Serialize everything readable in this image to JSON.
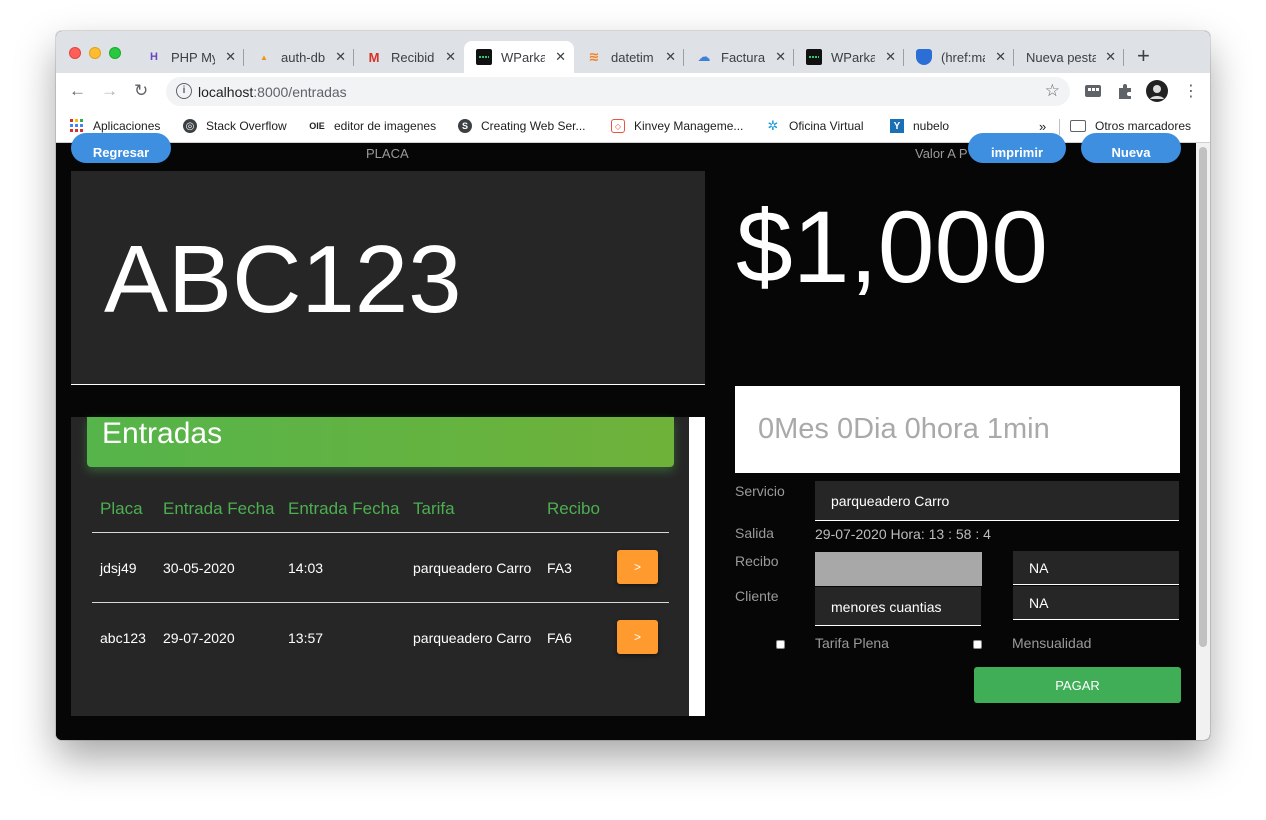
{
  "browser": {
    "tabs": [
      {
        "title": "PHP My",
        "icon": "phpmyadmin-icon",
        "color": "#6c45c4"
      },
      {
        "title": "auth-db",
        "icon": "pma-icon",
        "color": "#f29111"
      },
      {
        "title": "Recibid",
        "icon": "gmail-icon",
        "color": "#d93025"
      },
      {
        "title": "WParka",
        "icon": "wparking-icon",
        "color": "#111111"
      },
      {
        "title": "datetim",
        "icon": "stackoverflow-icon",
        "color": "#f48024"
      },
      {
        "title": "Factura",
        "icon": "cloud-icon",
        "color": "#3d7fd9"
      },
      {
        "title": "WParka",
        "icon": "wparking-icon",
        "color": "#111111"
      },
      {
        "title": "(href:ma",
        "icon": "shield-icon",
        "color": "#2b6fd6"
      },
      {
        "title": "Nueva pesta",
        "icon": "",
        "color": ""
      }
    ],
    "active_tab": 3,
    "url_host": "localhost",
    "url_rest": ":8000/entradas",
    "bookmarks": [
      {
        "label": "Aplicaciones",
        "icon": "apps-grid-icon"
      },
      {
        "label": "Stack Overflow",
        "icon": "globe-icon"
      },
      {
        "label": "editor de imagenes",
        "icon": "oie-icon",
        "icon_text": "OIE"
      },
      {
        "label": "Creating Web Ser...",
        "icon": "s-logo-icon"
      },
      {
        "label": "Kinvey Manageme...",
        "icon": "kinvey-icon"
      },
      {
        "label": "Oficina Virtual",
        "icon": "star-logo-icon"
      },
      {
        "label": "nubelo",
        "icon": "nubelo-icon"
      }
    ],
    "overflow": "»",
    "other_bookmarks": "Otros marcadores"
  },
  "header": {
    "back_label": "Regresar",
    "placa_label": "PLACA",
    "valor_label": "Valor A P",
    "print_label": "imprimir",
    "new_label": "Nueva"
  },
  "plate": "ABC123",
  "amount": "$1,000",
  "duration": "0Mes 0Dia 0hora 1min",
  "entradas": {
    "title": "Entradas",
    "columns": [
      "Placa",
      "Entrada Fecha",
      "Entrada Fecha",
      "Tarifa",
      "Recibo"
    ],
    "rows": [
      {
        "placa": "jdsj49",
        "fecha": "30-05-2020",
        "hora": "14:03",
        "tarifa": "parqueadero Carro",
        "recibo": "FA3",
        "action": ">"
      },
      {
        "placa": "abc123",
        "fecha": "29-07-2020",
        "hora": "13:57",
        "tarifa": "parqueadero Carro",
        "recibo": "FA6",
        "action": ">"
      }
    ]
  },
  "form": {
    "servicio_label": "Servicio",
    "servicio_value": "parqueadero Carro",
    "salida_label": "Salida",
    "salida_value": "29-07-2020 Hora: 13 : 58 : 4",
    "recibo_label": "Recibo",
    "recibo_na": "NA",
    "cliente_label": "Cliente",
    "cliente_value": "menores cuantias",
    "cliente_na": "NA",
    "tarifa_plena_label": "Tarifa Plena",
    "mensualidad_label": "Mensualidad",
    "pagar_label": "PAGAR"
  },
  "colors": {
    "accent_blue": "#3f8fe0",
    "green_header": "#55b44a",
    "orange_button": "#ff9a2e",
    "pay_green": "#3fae57"
  }
}
